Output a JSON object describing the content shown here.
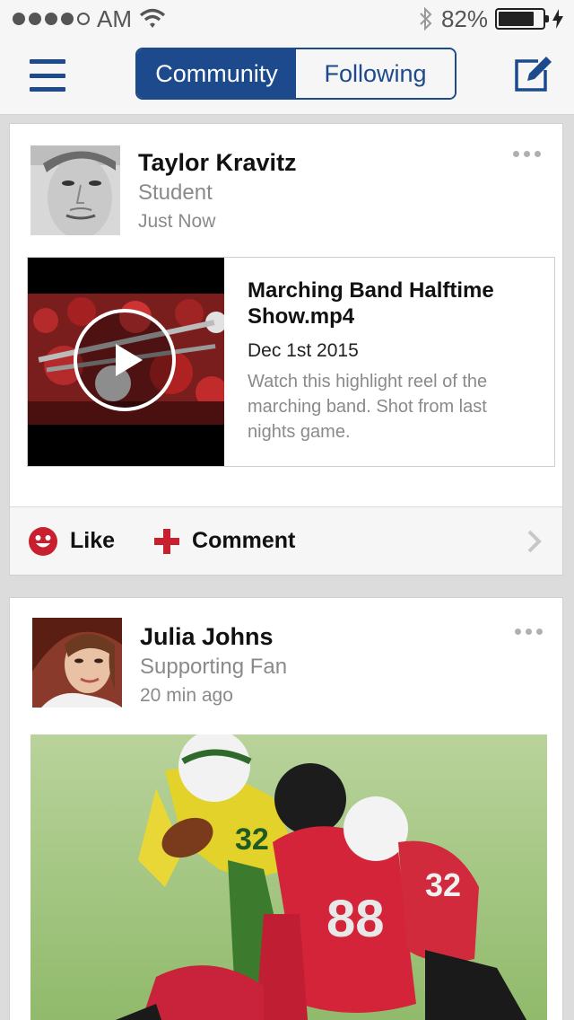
{
  "status_bar": {
    "carrier_time": "AM",
    "battery_pct": "82%",
    "battery_level": 0.82,
    "icons": [
      "signal-dots",
      "wifi-icon",
      "bluetooth-icon",
      "battery-icon",
      "charging-bolt-icon"
    ]
  },
  "nav": {
    "menu_icon": "hamburger-menu-icon",
    "tabs": [
      {
        "label": "Community",
        "active": true
      },
      {
        "label": "Following",
        "active": false
      }
    ],
    "compose_icon": "compose-icon",
    "accent_color": "#1d4a8c"
  },
  "posts": [
    {
      "author": "Taylor Kravitz",
      "role": "Student",
      "time": "Just Now",
      "attachment": {
        "type": "video",
        "title": "Marching Band Halftime Show.mp4",
        "date": "Dec 1st 2015",
        "description": "Watch this highlight reel of the marching band. Shot from last nights game."
      },
      "actions": {
        "like_label": "Like",
        "comment_label": "Comment"
      }
    },
    {
      "author": "Julia Johns",
      "role": "Supporting Fan",
      "time": "20 min ago",
      "attachment": {
        "type": "photo",
        "jersey_numbers": [
          "32",
          "88",
          "32"
        ]
      }
    }
  ],
  "colors": {
    "like_icon": "#c8202f",
    "comment_icon": "#c8202f",
    "card_bg": "#ffffff",
    "feed_bg": "#dcdcdc"
  }
}
